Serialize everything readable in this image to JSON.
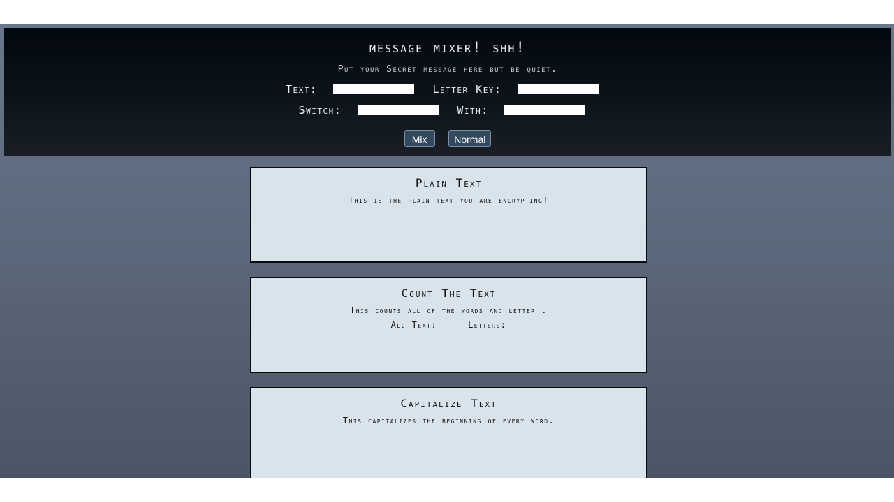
{
  "header": {
    "title": "Message Mixer! Shh!",
    "subtitle": "Put your Secret message here but be quiet.",
    "text_label": "Text:",
    "text_value": "",
    "letter_key_label": "Letter Key:",
    "letter_key_value": "",
    "switch_label": "Switch:",
    "switch_value": "",
    "with_label": "With:",
    "with_value": "",
    "mix_button": "Mix",
    "normal_button": "Normal"
  },
  "cards": [
    {
      "title": "Plain Text",
      "description": "This is the plain text you are encrypting!"
    },
    {
      "title": "Count The Text",
      "description": "This counts all of the words and letter   .",
      "all_text_label": "All Text:",
      "letters_label": "Letters:"
    },
    {
      "title": "Capitalize Text",
      "description": "This capitalizes the beginning of every word."
    }
  ],
  "colors": {
    "header_bg": "#03080f",
    "card_bg": "#d9e3ec",
    "button_bg": "#34495e",
    "page_bg": "#5d697c"
  }
}
